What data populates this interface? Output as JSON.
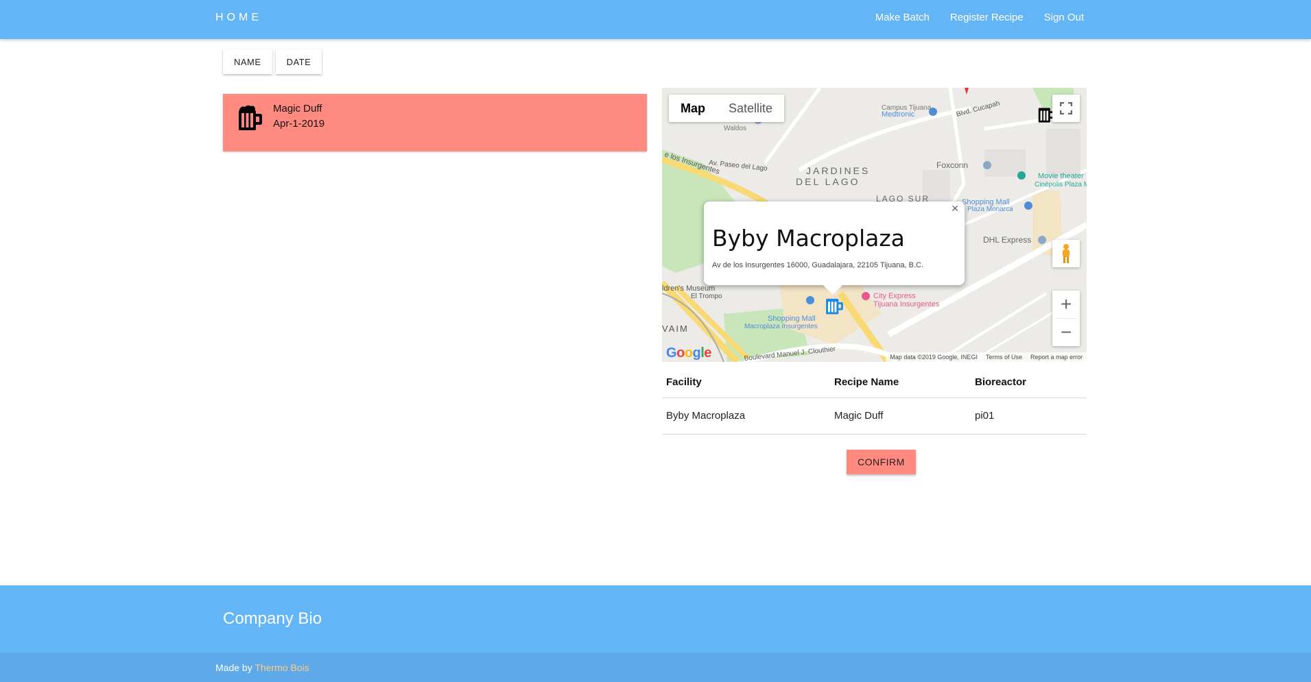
{
  "navbar": {
    "brand": "HOME",
    "links": [
      "Make Batch",
      "Register Recipe",
      "Sign Out"
    ]
  },
  "sort_buttons": [
    "NAME",
    "DATE"
  ],
  "batches": [
    {
      "name": "Magic Duff",
      "date": "Apr-1-2019",
      "icon": "beer-mug-icon",
      "color": "#ff8a80"
    }
  ],
  "map": {
    "type_buttons": [
      "Map",
      "Satellite"
    ],
    "active_type": "Map",
    "info_window": {
      "title": "Byby Macroplaza",
      "address": "Av de los Insurgentes 16000, Guadalajara, 22105 Tijuana, B.C."
    },
    "labels": {
      "medtronic": "Medtronic",
      "foxconn": "Foxconn",
      "jardines": "JARDINES",
      "del_lago": "DEL LAGO",
      "lago_sur": "LAGO SUR",
      "shopping_monarca": "Shopping Mall",
      "plaza_monarca": "Plaza Monarca",
      "dhl": "DHL Express",
      "movie": "Movie theater",
      "cinepolis": "Cinépolis Plaza M",
      "museum": "ldren's Museum",
      "trompo": "El Trompo",
      "city_express": "City Express",
      "city_express2": "Tijuana Insurgentes",
      "shopping_macro": "Shopping Mall",
      "macroplaza": "Macroplaza Insurgentes",
      "waim": "VAIM",
      "blvd": "Boulevard Manuel J. Clouthier",
      "paseo": "Av. Paseo del Lago",
      "insurgentes": "e los Insurgentes",
      "waldos": "Waldos",
      "cucapah": "Blvd. Cucapah",
      "campus": "Campus Tijuana"
    },
    "footer": [
      "Map data ©2019 Google, INEGI",
      "Terms of Use",
      "Report a map error"
    ],
    "google": "Google",
    "accent_marker": "#1e88e5"
  },
  "table": {
    "headers": [
      "Facility",
      "Recipe Name",
      "Bioreactor"
    ],
    "rows": [
      [
        "Byby Macroplaza",
        "Magic Duff",
        "pi01"
      ]
    ]
  },
  "confirm_label": "CONFIRM",
  "footer": {
    "title": "Company Bio",
    "made_by": "Made by ",
    "made_by_link": "Thermo Bois"
  },
  "colors": {
    "primary": "#64b5f6",
    "accent": "#ff8a80",
    "link": "#ffcc80"
  }
}
